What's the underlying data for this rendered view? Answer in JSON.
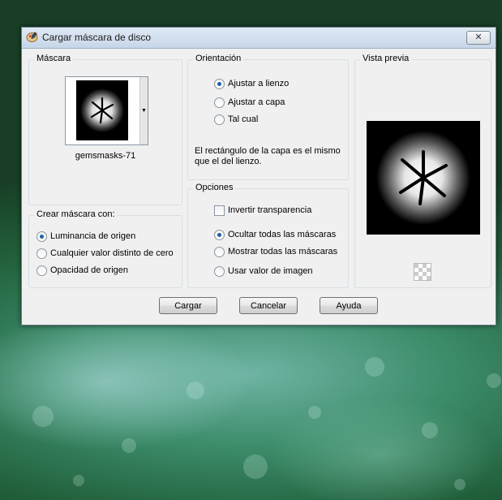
{
  "window": {
    "title": "Cargar máscara de disco",
    "close_label": "✕"
  },
  "mascara": {
    "label": "Máscara",
    "name": "gemsmasks-71"
  },
  "crear_mascara": {
    "label": "Crear máscara con:",
    "options": [
      "Luminancia de origen",
      "Cualquier valor distinto de cero",
      "Opacidad de origen"
    ],
    "selected": "Luminancia de origen"
  },
  "orientacion": {
    "label": "Orientación",
    "options": [
      "Ajustar a lienzo",
      "Ajustar a capa",
      "Tal cual"
    ],
    "selected": "Ajustar a lienzo",
    "description": "El rectángulo de la capa es el mismo que el del lienzo."
  },
  "opciones": {
    "label": "Opciones",
    "invert_label": "Invertir transparencia",
    "invert_checked": false,
    "options": [
      "Ocultar todas las máscaras",
      "Mostrar todas las máscaras",
      "Usar valor de imagen"
    ],
    "selected": "Ocultar todas las máscaras"
  },
  "vista_previa": {
    "label": "Vista previa"
  },
  "buttons": {
    "load": "Cargar",
    "cancel": "Cancelar",
    "help": "Ayuda"
  },
  "colors": {
    "dialog_bg": "#f0f0f0",
    "radio_dot": "#1f5fa8",
    "title_gradient_top": "#dfe9f5",
    "title_gradient_bottom": "#c7d6e8"
  },
  "icons": {
    "app_icon": "paint-palette-icon",
    "close": "close-icon",
    "dropdown": "chevron-down-icon",
    "transparency": "checkerboard-icon"
  }
}
